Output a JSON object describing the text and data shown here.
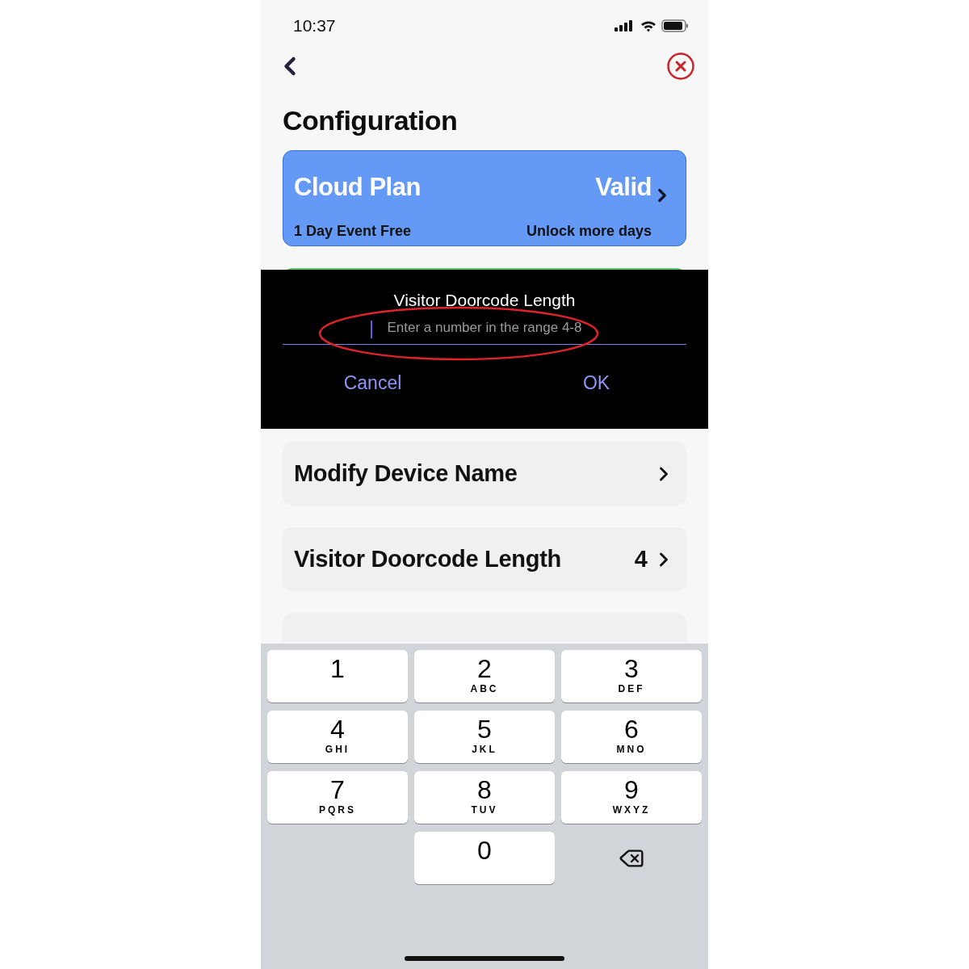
{
  "status_bar": {
    "time": "10:37"
  },
  "title": "Configuration",
  "plan_card": {
    "title": "Cloud Plan",
    "status": "Valid",
    "subtitle": "1 Day Event Free",
    "action": "Unlock more days"
  },
  "settings": [
    {
      "label": "Modify Device Name"
    },
    {
      "label": "Visitor Doorcode Length",
      "value": "4"
    }
  ],
  "dialog": {
    "title": "Visitor Doorcode Length",
    "field": {
      "placeholder": "Enter a number in the range 4-8"
    },
    "buttons": [
      "Cancel",
      "OK"
    ]
  },
  "keypad": [
    {
      "kind": "digit",
      "digit": "1"
    },
    {
      "kind": "digit",
      "digit": "2",
      "letters": "ABC"
    },
    {
      "kind": "digit",
      "digit": "3",
      "letters": "DEF"
    },
    {
      "kind": "digit",
      "digit": "4",
      "letters": "GHI"
    },
    {
      "kind": "digit",
      "digit": "5",
      "letters": "JKL"
    },
    {
      "kind": "digit",
      "digit": "6",
      "letters": "MNO"
    },
    {
      "kind": "digit",
      "digit": "7",
      "letters": "PQRS"
    },
    {
      "kind": "digit",
      "digit": "8",
      "letters": "TUV"
    },
    {
      "kind": "digit",
      "digit": "9",
      "letters": "WXYZ"
    },
    {
      "kind": "blank"
    },
    {
      "kind": "digit",
      "digit": "0"
    },
    {
      "kind": "delete"
    }
  ]
}
